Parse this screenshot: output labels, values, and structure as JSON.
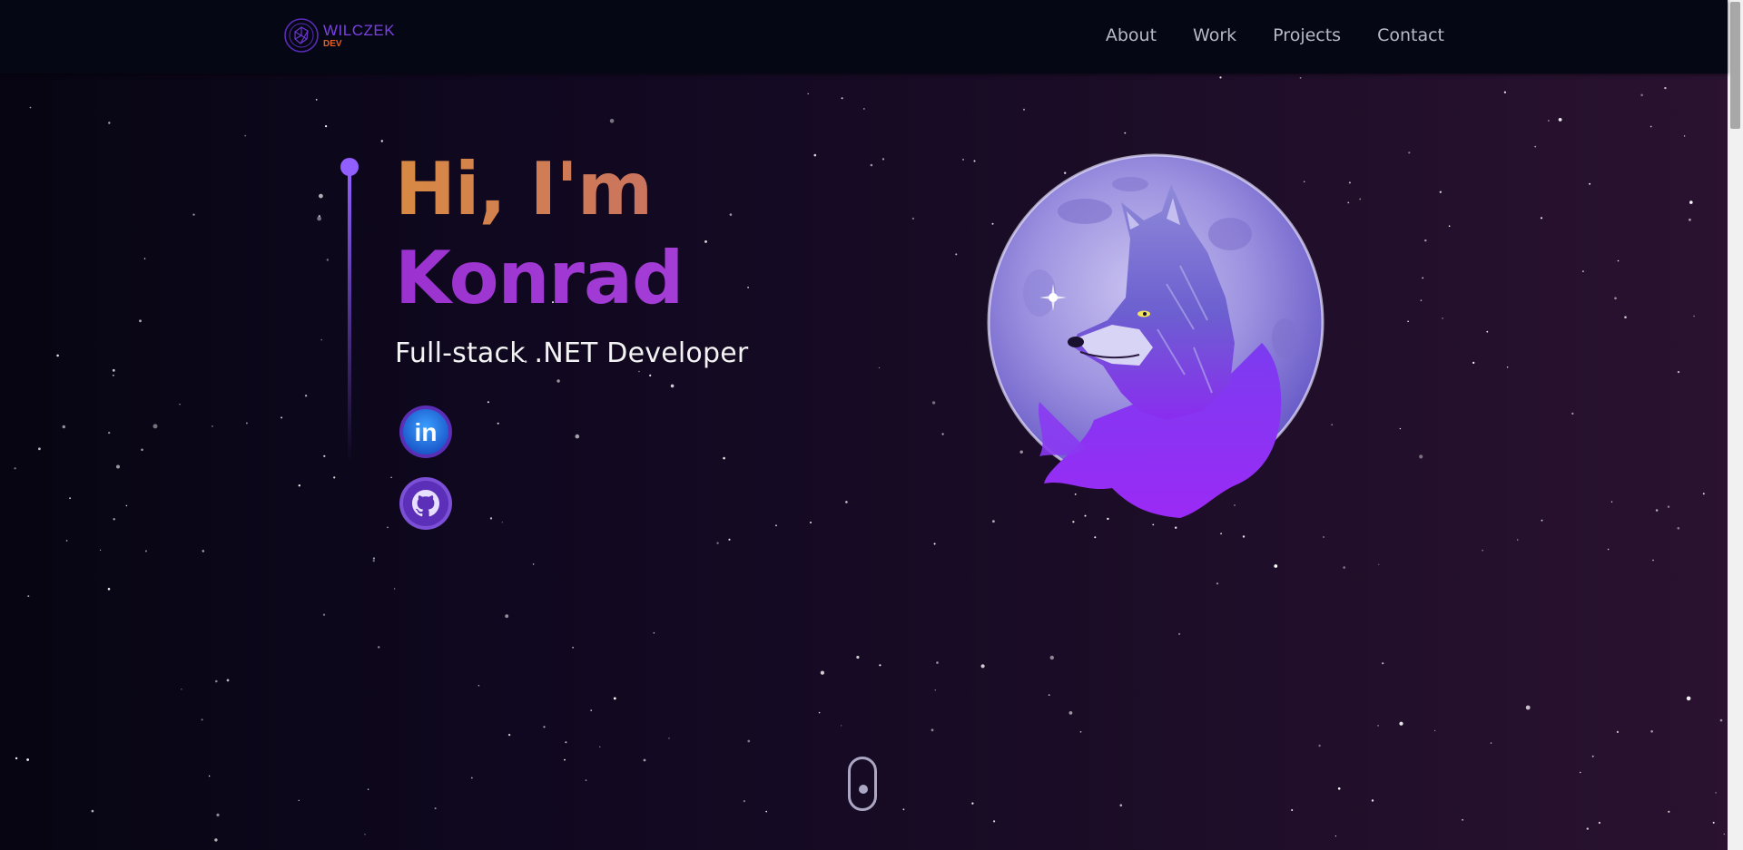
{
  "logo": {
    "name": "WILCZEK",
    "sub": "DEV"
  },
  "nav": {
    "items": [
      "About",
      "Work",
      "Projects",
      "Contact"
    ]
  },
  "hero": {
    "greeting": "Hi, I'm",
    "name": "Konrad",
    "role": "Full-stack .NET Developer"
  },
  "social": {
    "linkedin_label": "in"
  },
  "colors": {
    "accent": "#915eff",
    "greeting": "#d98646",
    "name": "#9b35d6",
    "nav_text": "#b6b9c6",
    "nav_bg": "#050814"
  }
}
